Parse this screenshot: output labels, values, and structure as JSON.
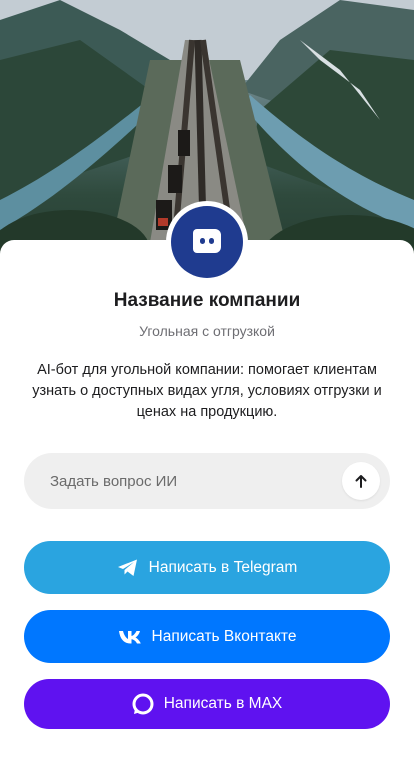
{
  "profile": {
    "company_name": "Название компании",
    "category": "Угольная с отгрузкой",
    "description": "AI-бот для угольной компании: помогает клиентам узнать о доступных видах угля, условиях отгрузки и ценах на продукцию.",
    "avatar_icon": "chat-bot-icon"
  },
  "ask": {
    "placeholder": "Задать вопрос ИИ",
    "send_icon": "arrow-up-icon"
  },
  "buttons": {
    "telegram": {
      "label": "Написать в Telegram",
      "icon": "telegram-icon",
      "color": "#2aa4e0"
    },
    "vk": {
      "label": "Написать Вконтакте",
      "icon": "vk-icon",
      "color": "#0077ff"
    },
    "max": {
      "label": "Написать в MAX",
      "icon": "max-icon",
      "color": "#5f12f0"
    }
  },
  "colors": {
    "avatar_bg": "#1f3b8f",
    "input_bg": "#efefef"
  }
}
